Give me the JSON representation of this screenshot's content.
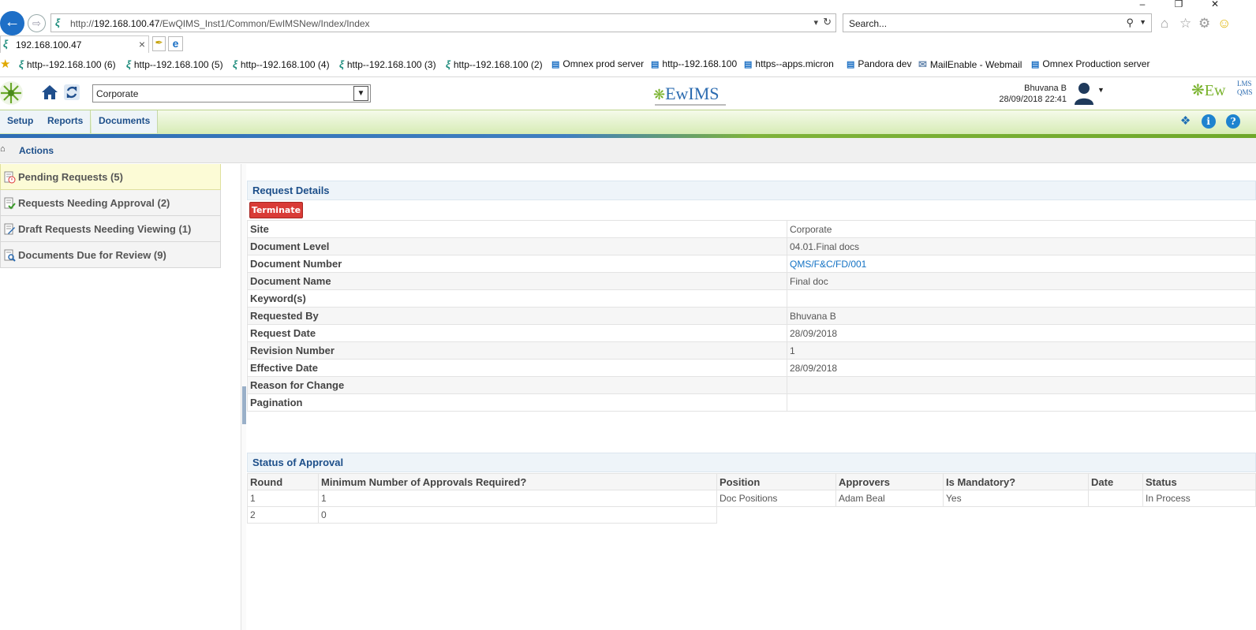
{
  "browser": {
    "window_controls": [
      "–",
      "❐",
      "✕"
    ],
    "url_prefix": "http://",
    "url_host": "192.168.100.47",
    "url_path": "/EwQIMS_Inst1/Common/EwIMSNew/Index/Index",
    "search_placeholder": "Search...",
    "tab_title": "192.168.100.47",
    "favorites": [
      {
        "label": "http--192.168.100 (6)",
        "icon": "ewims-icon"
      },
      {
        "label": "http--192.168.100 (5)",
        "icon": "ewims-icon"
      },
      {
        "label": "http--192.168.100 (4)",
        "icon": "ewims-icon"
      },
      {
        "label": "http--192.168.100 (3)",
        "icon": "ewims-icon"
      },
      {
        "label": "http--192.168.100 (2)",
        "icon": "ewims-icon"
      },
      {
        "label": "Omnex prod server",
        "icon": "ie-page-icon"
      },
      {
        "label": "http--192.168.100",
        "icon": "ie-page-icon"
      },
      {
        "label": "https--apps.micron",
        "icon": "ie-page-icon"
      },
      {
        "label": "Pandora dev",
        "icon": "ie-page-icon"
      },
      {
        "label": "MailEnable - Webmail",
        "icon": "mail-icon"
      },
      {
        "label": "Omnex Production server",
        "icon": "ie-page-icon"
      }
    ]
  },
  "header": {
    "site_value": "Corporate",
    "center_logo": "EwIMS",
    "user_name": "Bhuvana B",
    "user_datetime": "28/09/2018 22:41",
    "right_logo": "Ew",
    "right_logo_top": "LMS",
    "right_logo_bottom": "QMS"
  },
  "menu": {
    "items": [
      "Setup",
      "Reports",
      "Documents"
    ],
    "tools": [
      "pin-icon",
      "info-icon",
      "help-icon"
    ]
  },
  "breadcrumb": {
    "label": "Actions"
  },
  "actions": [
    {
      "label": "Pending Requests (5)",
      "active": true
    },
    {
      "label": "Requests Needing Approval (2)",
      "active": false
    },
    {
      "label": "Draft Requests Needing Viewing (1)",
      "active": false
    },
    {
      "label": "Documents Due for Review (9)",
      "active": false
    }
  ],
  "request_details": {
    "title": "Request Details",
    "terminate_label": "Terminate",
    "rows": [
      {
        "key": "Site",
        "value": "Corporate"
      },
      {
        "key": "Document Level",
        "value": "04.01.Final docs"
      },
      {
        "key": "Document Number",
        "value": "QMS/F&C/FD/001"
      },
      {
        "key": "Document Name",
        "value": "Final doc"
      },
      {
        "key": "Keyword(s)",
        "value": ""
      },
      {
        "key": "Requested By",
        "value": "Bhuvana B"
      },
      {
        "key": "Request Date",
        "value": "28/09/2018"
      },
      {
        "key": "Revision Number",
        "value": "1"
      },
      {
        "key": "Effective Date",
        "value": "28/09/2018"
      },
      {
        "key": "Reason for Change",
        "value": ""
      },
      {
        "key": "Pagination",
        "value": ""
      }
    ]
  },
  "approval": {
    "title": "Status of Approval",
    "headers": [
      "Round",
      "Minimum Number of Approvals Required?",
      "Position",
      "Approvers",
      "Is Mandatory?",
      "Date",
      "Status"
    ],
    "rows": [
      {
        "round": "1",
        "min": "1",
        "position": "Doc Positions",
        "approvers": "Adam Beal",
        "mandatory": "Yes",
        "date": "",
        "status": "In Process"
      },
      {
        "round": "2",
        "min": "0"
      }
    ]
  }
}
